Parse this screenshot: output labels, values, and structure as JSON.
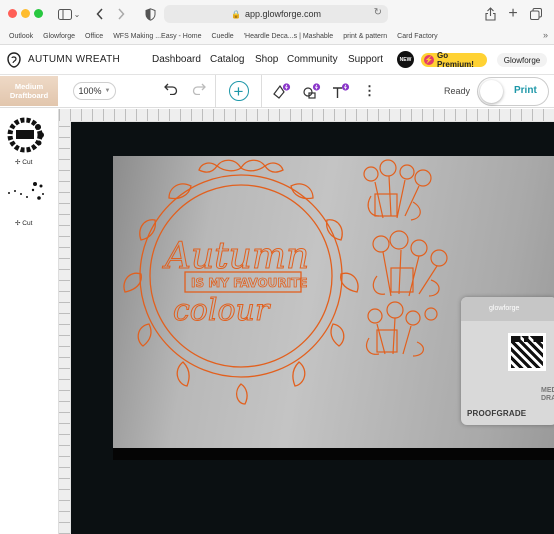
{
  "browser": {
    "url": "app.glowforge.com",
    "bookmarks": [
      "Outlook",
      "Glowforge",
      "Office",
      "WFS Making ...Easy - Home",
      "Cuedle",
      "'Heardle Deca...s | Mashable",
      "print & pattern",
      "Card Factory"
    ]
  },
  "nav": {
    "project_title": "AUTUMN WREATH",
    "links": [
      "Dashboard",
      "Catalog",
      "Shop",
      "Community",
      "Support"
    ],
    "new_badge": "NEW",
    "premium_label": "Go Premium!",
    "account_label": "Glowforge"
  },
  "toolbar": {
    "material_label": "Medium Draftboard",
    "zoom": "100%",
    "status": "Ready",
    "print_label": "Print"
  },
  "designs": [
    {
      "label": "Cut"
    },
    {
      "label": "Cut"
    }
  ],
  "canvas": {
    "artwork_text": [
      "Autumn",
      "IS MY FAVOURITE",
      "colour"
    ],
    "qr_card": {
      "header": "glowforge",
      "material_text": "MEDI DRAFTBO",
      "brand": "PROOFGRADE"
    }
  },
  "colors": {
    "accent": "#1d97a8",
    "engrave_orange": "#e2601e",
    "premium_yellow": "#ffd233",
    "bed": "#0b1012"
  }
}
